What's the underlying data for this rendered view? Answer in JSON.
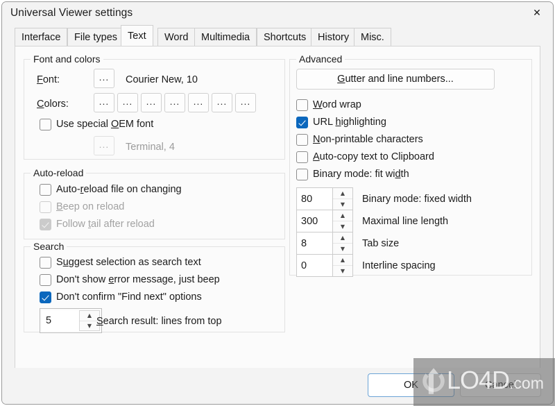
{
  "window": {
    "title": "Universal Viewer settings",
    "close_icon": "close-icon"
  },
  "tabs": [
    {
      "label": "Interface",
      "selected": false
    },
    {
      "label": "File types",
      "selected": false
    },
    {
      "label": "Text",
      "selected": true
    },
    {
      "label": "Word",
      "selected": false
    },
    {
      "label": "Multimedia",
      "selected": false
    },
    {
      "label": "Shortcuts",
      "selected": false
    },
    {
      "label": "History",
      "selected": false
    },
    {
      "label": "Misc.",
      "selected": false
    }
  ],
  "font_and_colors": {
    "title": "Font and colors",
    "font_label": "Font:",
    "font_browse": "...",
    "font_value": "Courier New, 10",
    "colors_label": "Colors:",
    "color_browse": "...",
    "color_button_count": 7,
    "oem_checkbox": {
      "label": "Use special OEM font",
      "checked": false
    },
    "oem_browse": "...",
    "oem_value": "Terminal, 4"
  },
  "auto_reload": {
    "title": "Auto-reload",
    "items": [
      {
        "label": "Auto-reload file on changing",
        "checked": false,
        "disabled": false
      },
      {
        "label": "Beep on reload",
        "checked": false,
        "disabled": true
      },
      {
        "label": "Follow tail after reload",
        "checked": true,
        "disabled": true
      }
    ]
  },
  "search": {
    "title": "Search",
    "items": [
      {
        "label": "Suggest selection as search text",
        "checked": false,
        "disabled": false
      },
      {
        "label": "Don't show error message, just beep",
        "checked": false,
        "disabled": false
      },
      {
        "label": "Don't confirm \"Find next\" options",
        "checked": true,
        "disabled": false
      }
    ],
    "spinner": {
      "value": "5",
      "label": "Search result: lines from top"
    }
  },
  "advanced": {
    "title": "Advanced",
    "gutter_button": "Gutter and line numbers...",
    "items": [
      {
        "label": "Word wrap",
        "checked": false
      },
      {
        "label": "URL highlighting",
        "checked": true
      },
      {
        "label": "Non-printable characters",
        "checked": false
      },
      {
        "label": "Auto-copy text to Clipboard",
        "checked": false
      },
      {
        "label": "Binary mode: fit width",
        "checked": false
      }
    ],
    "spinners": [
      {
        "value": "80",
        "label": "Binary mode: fixed width"
      },
      {
        "value": "300",
        "label": "Maximal line length"
      },
      {
        "value": "8",
        "label": "Tab size"
      },
      {
        "value": "0",
        "label": "Interline spacing"
      }
    ]
  },
  "footer": {
    "ok_label": "OK",
    "cancel_label": "Cancel"
  },
  "watermark": {
    "brand": "LO4D",
    "suffix": ".com"
  },
  "colors": {
    "accent_checkbox": "#0b67bd",
    "default_button_border": "#6ba3d6",
    "window_background": "#f3f3f3",
    "page_background": "#fbfbfb"
  }
}
